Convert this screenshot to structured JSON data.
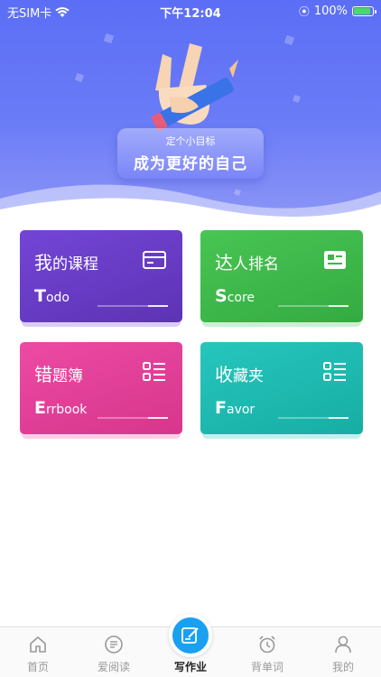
{
  "status_bar": {
    "carrier": "无SIM卡",
    "time": "下午12:04",
    "battery": "100%",
    "battery_level": 1.0
  },
  "hero": {
    "subtitle": "定个小目标",
    "title": "成为更好的自己"
  },
  "cards": [
    {
      "title_first": "我",
      "title_rest": "的课程",
      "sub_first": "T",
      "sub_rest": "odo",
      "icon": "card-icon",
      "color": "#6a3fc4"
    },
    {
      "title_first": "达",
      "title_rest": "人排名",
      "sub_first": "S",
      "sub_rest": "core",
      "icon": "id-card-icon",
      "color": "#3db64a"
    },
    {
      "title_first": "错",
      "title_rest": "题簿",
      "sub_first": "E",
      "sub_rest": "rrbook",
      "icon": "list-icon",
      "color": "#e0439a"
    },
    {
      "title_first": "收",
      "title_rest": "藏夹",
      "sub_first": "F",
      "sub_rest": "avor",
      "icon": "list-icon",
      "color": "#1fbcb3"
    }
  ],
  "tab_bar": {
    "items": [
      {
        "label": "首页",
        "icon": "home-icon"
      },
      {
        "label": "爱阅读",
        "icon": "read-icon"
      },
      {
        "label": "写作业",
        "icon": "edit-icon",
        "active": true
      },
      {
        "label": "背单词",
        "icon": "alarm-icon"
      },
      {
        "label": "我的",
        "icon": "user-icon"
      }
    ]
  }
}
